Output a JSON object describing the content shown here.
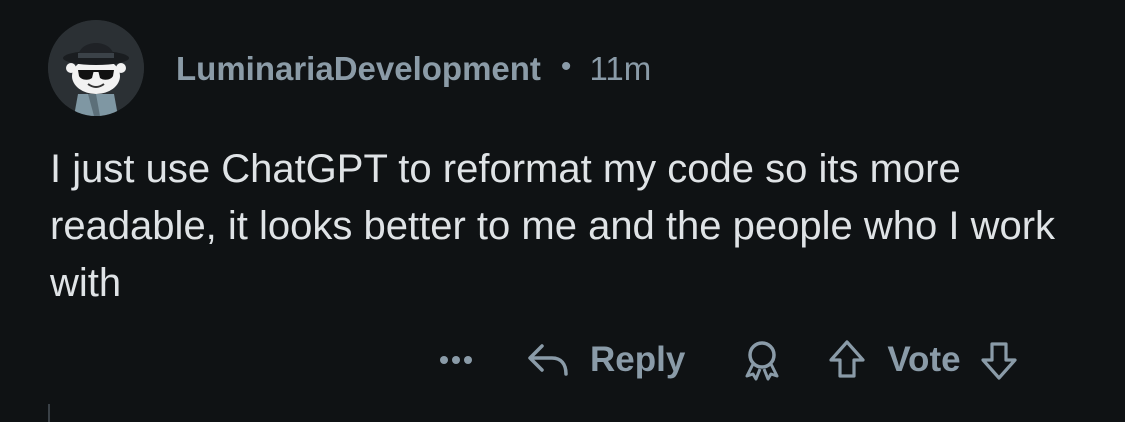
{
  "comment": {
    "author": "LuminariaDevelopment",
    "separator": "•",
    "time": "11m",
    "text": "I just use ChatGPT to reformat my code so its more readable, it looks better to me and the people who I work with"
  },
  "actions": {
    "more_icon": "ellipsis-icon",
    "reply_icon": "reply-arrow-icon",
    "reply_label": "Reply",
    "award_icon": "award-icon",
    "upvote_icon": "arrow-up-icon",
    "vote_label": "Vote",
    "downvote_icon": "arrow-down-icon"
  },
  "colors": {
    "background": "#0f1214",
    "meta_text": "#8a9ba8",
    "body_text": "#dfe3e6"
  }
}
